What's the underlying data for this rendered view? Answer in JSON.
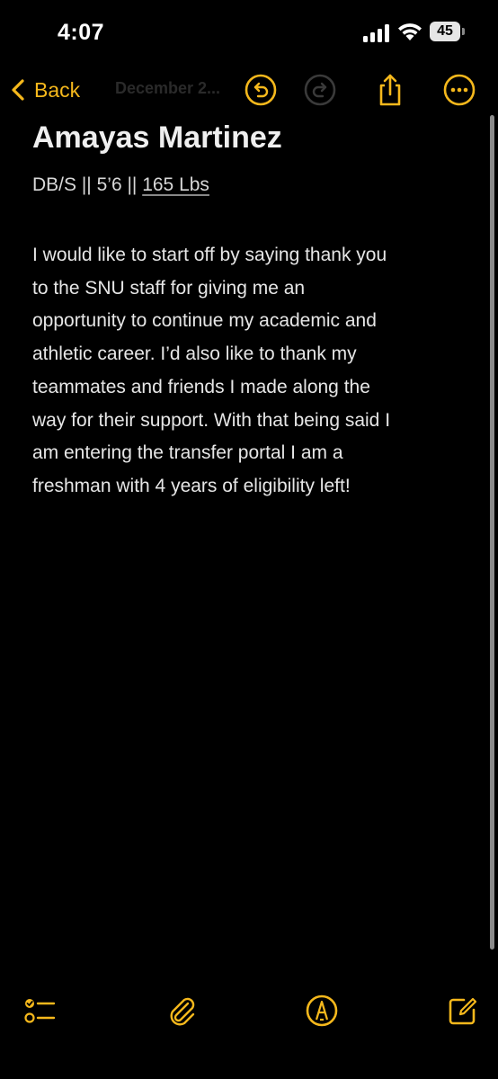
{
  "status_bar": {
    "time": "4:07",
    "battery": "45"
  },
  "nav": {
    "back_label": "Back",
    "faded_header": "December 2..."
  },
  "note": {
    "title": "Amayas Martinez",
    "subtitle_prefix": "DB/S || 5’6 || ",
    "subtitle_link": "165 Lbs",
    "body": "I would like to start off by saying thank you\nto the SNU staff for giving me an\nopportunity to continue my academic and\nathletic career. I’d also like to thank my\nteammates and friends I made along the\nway for their support. With that being said I\nam entering the transfer portal I am a\nfreshman with 4 years of eligibility left!"
  },
  "icons": {
    "back": "chevron-left-icon",
    "undo": "undo-icon",
    "redo": "redo-icon",
    "share": "share-icon",
    "more": "ellipsis-circle-icon",
    "checklist": "checklist-icon",
    "attachment": "paperclip-icon",
    "markup": "markup-pen-icon",
    "compose": "compose-icon"
  },
  "colors": {
    "accent": "#f5b81c",
    "background": "#000000",
    "text": "#e6e6e6"
  }
}
